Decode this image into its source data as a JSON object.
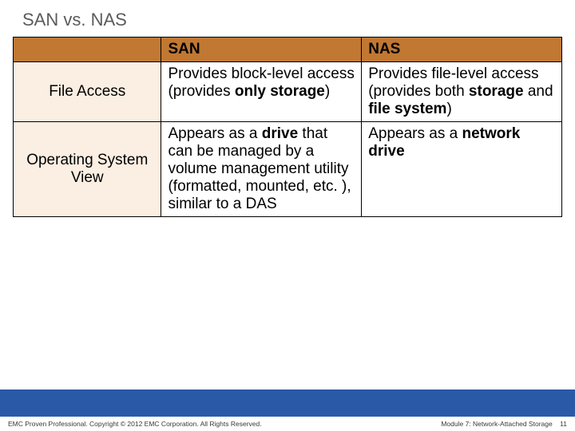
{
  "slide": {
    "title": "SAN vs. NAS"
  },
  "table": {
    "headers": {
      "blank": "",
      "san": "SAN",
      "nas": "NAS"
    },
    "rows": [
      {
        "label": "File Access",
        "san_html": "Provides block-level access (provides <b>only storage</b>)",
        "nas_html": "Provides file-level access (provides both <b>storage</b> and <b>file system</b>)"
      },
      {
        "label": "Operating System View",
        "san_html": "Appears as a <b>drive</b> that can be managed by a volume management utility (formatted, mounted, etc. ), similar to a DAS",
        "nas_html": "Appears as a <b>network drive</b>"
      }
    ]
  },
  "footer": {
    "left": "EMC Proven Professional. Copyright © 2012 EMC Corporation. All Rights Reserved.",
    "right_prefix": "Module 7: Network-Attached Storage",
    "page": "11"
  }
}
